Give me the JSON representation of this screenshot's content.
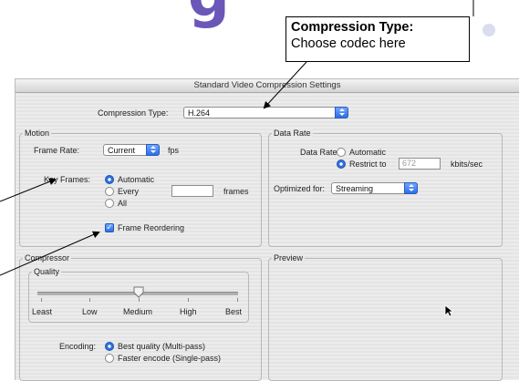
{
  "slide": {
    "title_fragment": "g"
  },
  "callout": {
    "title": "Compression Type:",
    "subtitle": "Choose codec here"
  },
  "dialog": {
    "title": "Standard Video Compression Settings",
    "compression_type": {
      "label": "Compression Type:",
      "value": "H.264"
    },
    "motion": {
      "group_title": "Motion",
      "frame_rate_label": "Frame Rate:",
      "frame_rate_value": "Current",
      "frame_rate_unit": "fps",
      "key_frames_label": "Key Frames:",
      "key_frame_options": [
        "Automatic",
        "Every",
        "All"
      ],
      "key_frame_selected": "Automatic",
      "every_value": "",
      "every_unit": "frames",
      "frame_reordering_label": "Frame Reordering",
      "frame_reordering_checked": true
    },
    "data_rate": {
      "group_title": "Data Rate",
      "label": "Data Rate:",
      "options": [
        "Automatic",
        "Restrict to"
      ],
      "selected": "Restrict to",
      "restrict_value": "672",
      "unit": "kbits/sec",
      "optimized_label": "Optimized for:",
      "optimized_value": "Streaming"
    },
    "compressor": {
      "group_title": "Compressor",
      "quality_title": "Quality",
      "quality_labels": [
        "Least",
        "Low",
        "Medium",
        "High",
        "Best"
      ],
      "quality_level": "Medium",
      "encoding_label": "Encoding:",
      "encoding_options": [
        "Best quality (Multi-pass)",
        "Faster encode (Single-pass)"
      ],
      "encoding_selected": "Best quality (Multi-pass)"
    },
    "preview": {
      "group_title": "Preview"
    }
  },
  "colors": {
    "accent": "#2e6ee6",
    "title_purple": "#6a57b8"
  }
}
